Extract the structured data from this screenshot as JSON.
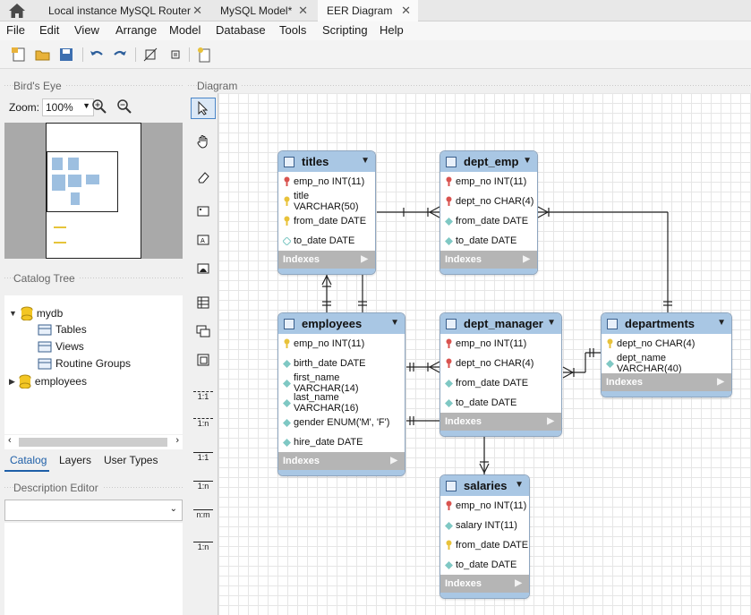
{
  "tabs": [
    "Local instance MySQL Router",
    "MySQL Model*",
    "EER Diagram"
  ],
  "menu": [
    "File",
    "Edit",
    "View",
    "Arrange",
    "Model",
    "Database",
    "Tools",
    "Scripting",
    "Help"
  ],
  "left": {
    "birds_eye_title": "Bird's Eye",
    "zoom_label": "Zoom:",
    "zoom_value": "100%",
    "catalog_title": "Catalog Tree",
    "tree": [
      {
        "label": "mydb",
        "expanded": true
      },
      {
        "label": "Tables"
      },
      {
        "label": "Views"
      },
      {
        "label": "Routine Groups"
      },
      {
        "label": "employees",
        "expanded": false
      }
    ],
    "bottom_tabs": [
      "Catalog",
      "Layers",
      "User Types"
    ],
    "description_title": "Description Editor",
    "description_value": ""
  },
  "diagram": {
    "title": "Diagram",
    "tool_labels": [
      "1:1",
      "1:n",
      "1:1",
      "1:n",
      "n:m",
      "1:n"
    ],
    "indexes_label": "Indexes",
    "tables": {
      "titles": {
        "name": "titles",
        "columns": [
          {
            "name": "emp_no INT(11)",
            "kind": "pk"
          },
          {
            "name": "title VARCHAR(50)",
            "kind": "key"
          },
          {
            "name": "from_date DATE",
            "kind": "key"
          },
          {
            "name": "to_date DATE",
            "kind": "nullable"
          }
        ]
      },
      "dept_emp": {
        "name": "dept_emp",
        "columns": [
          {
            "name": "emp_no INT(11)",
            "kind": "pk"
          },
          {
            "name": "dept_no CHAR(4)",
            "kind": "pk"
          },
          {
            "name": "from_date DATE",
            "kind": "column"
          },
          {
            "name": "to_date DATE",
            "kind": "column"
          }
        ]
      },
      "employees": {
        "name": "employees",
        "columns": [
          {
            "name": "emp_no INT(11)",
            "kind": "key"
          },
          {
            "name": "birth_date DATE",
            "kind": "column"
          },
          {
            "name": "first_name VARCHAR(14)",
            "kind": "column"
          },
          {
            "name": "last_name VARCHAR(16)",
            "kind": "column"
          },
          {
            "name": "gender ENUM('M', 'F')",
            "kind": "column"
          },
          {
            "name": "hire_date DATE",
            "kind": "column"
          }
        ]
      },
      "dept_manager": {
        "name": "dept_manager",
        "columns": [
          {
            "name": "emp_no INT(11)",
            "kind": "pk"
          },
          {
            "name": "dept_no CHAR(4)",
            "kind": "pk"
          },
          {
            "name": "from_date DATE",
            "kind": "column"
          },
          {
            "name": "to_date DATE",
            "kind": "column"
          }
        ]
      },
      "departments": {
        "name": "departments",
        "columns": [
          {
            "name": "dept_no CHAR(4)",
            "kind": "key"
          },
          {
            "name": "dept_name VARCHAR(40)",
            "kind": "column"
          }
        ]
      },
      "salaries": {
        "name": "salaries",
        "columns": [
          {
            "name": "emp_no INT(11)",
            "kind": "pk"
          },
          {
            "name": "salary INT(11)",
            "kind": "column"
          },
          {
            "name": "from_date DATE",
            "kind": "key"
          },
          {
            "name": "to_date DATE",
            "kind": "column"
          }
        ]
      }
    }
  },
  "colors": {
    "header": "#a9c7e4",
    "indexes": "#b5b5b5",
    "pk_key": "#d9534f",
    "key": "#e8c23a",
    "column": "#7fc8c4"
  }
}
